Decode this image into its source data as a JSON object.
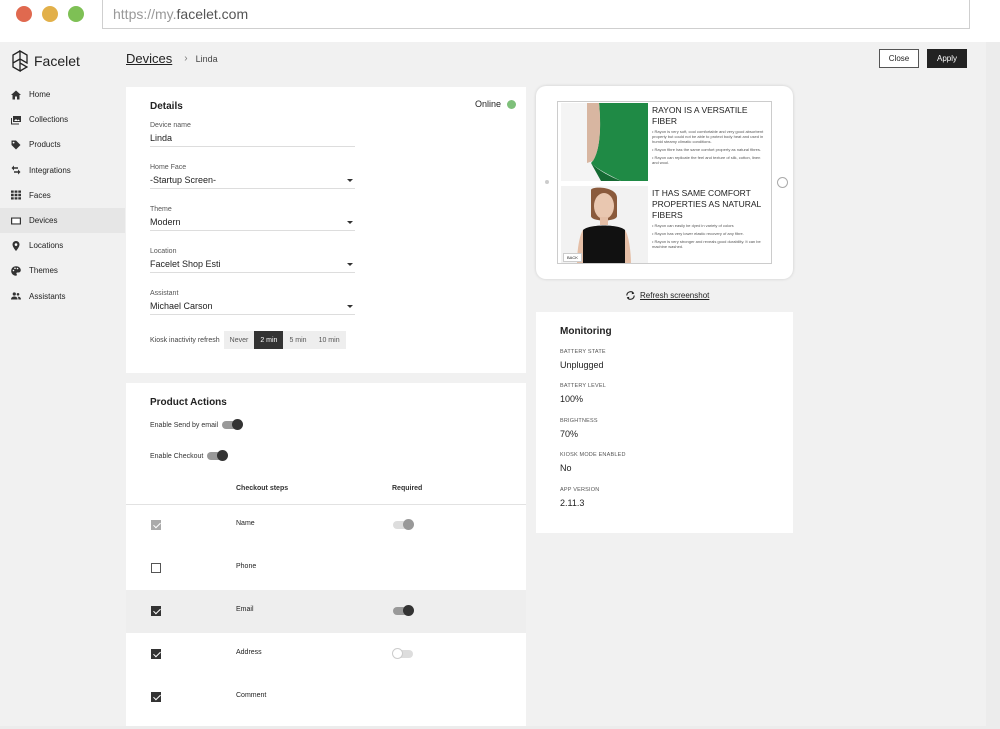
{
  "browser": {
    "url_scheme": "https://my.",
    "url_host": "facelet.com"
  },
  "app": {
    "logo_text": "Facelet"
  },
  "sidebar": {
    "items": [
      {
        "label": "Home",
        "icon": "home-icon"
      },
      {
        "label": "Collections",
        "icon": "collections-icon"
      },
      {
        "label": "Products",
        "icon": "tag-icon"
      },
      {
        "label": "Integrations",
        "icon": "swap-icon"
      },
      {
        "label": "Faces",
        "icon": "grid-icon"
      },
      {
        "label": "Devices",
        "icon": "tablet-icon",
        "active": true
      },
      {
        "label": "Locations",
        "icon": "pin-icon"
      },
      {
        "label": "Themes",
        "icon": "palette-icon"
      },
      {
        "label": "Assistants",
        "icon": "people-icon"
      }
    ]
  },
  "header": {
    "breadcrumb_root": "Devices",
    "breadcrumb_current": "Linda",
    "close_label": "Close",
    "apply_label": "Apply"
  },
  "details": {
    "title": "Details",
    "status": "Online",
    "status_color": "#7ec07a",
    "device_name_label": "Device name",
    "device_name_value": "Linda",
    "home_face_label": "Home Face",
    "home_face_value": "-Startup Screen-",
    "theme_label": "Theme",
    "theme_value": "Modern",
    "location_label": "Location",
    "location_value": "Facelet Shop Esti",
    "assistant_label": "Assistant",
    "assistant_value": "Michael Carson",
    "kiosk_label": "Kiosk inactivity refresh",
    "kiosk_options": [
      "Never",
      "2 min",
      "5 min",
      "10 min"
    ],
    "kiosk_selected": "2 min"
  },
  "product_actions": {
    "title": "Product Actions",
    "send_email_label": "Enable Send by email",
    "checkout_label": "Enable Checkout",
    "col_steps": "Checkout steps",
    "col_required": "Required",
    "rows": [
      {
        "name": "Name",
        "checked": true,
        "locked": true,
        "required": "on-locked"
      },
      {
        "name": "Phone",
        "checked": false,
        "locked": false,
        "required": "none"
      },
      {
        "name": "Email",
        "checked": true,
        "locked": false,
        "required": "on",
        "highlight": true
      },
      {
        "name": "Address",
        "checked": true,
        "locked": false,
        "required": "off"
      },
      {
        "name": "Comment",
        "checked": true,
        "locked": false,
        "required": "none"
      }
    ]
  },
  "preview": {
    "panel1_heading": "RAYON IS A VERSATILE FIBER",
    "panel1_p1": "• Rayon is very soft, cool comfortable and very good absorbent property but could not be able to protect body heat and used in humid steamy climatic conditions.",
    "panel1_p2": "• Rayon fibre has the same comfort property as natural fibres.",
    "panel1_p3": "• Rayon can replicate the feel and texture of silk, cotton, linen and wool.",
    "panel2_heading": "IT HAS SAME COMFORT PROPERTIES AS NATURAL FIBERS",
    "panel2_p1": "• Rayon can easily be dyed in variety of colors",
    "panel2_p2": "• Rayon has very lower elastic recovery of any fibre.",
    "panel2_p3": "• Rayon is very stronger and reveals good durability. It can be machine washed.",
    "back_label": "BACK",
    "refresh_label": "Refresh screenshot"
  },
  "monitoring": {
    "title": "Monitoring",
    "items": [
      {
        "label": "BATTERY STATE",
        "value": "Unplugged"
      },
      {
        "label": "BATTERY LEVEL",
        "value": "100%"
      },
      {
        "label": "BRIGHTNESS",
        "value": "70%"
      },
      {
        "label": "KIOSK MODE ENABLED",
        "value": "No"
      },
      {
        "label": "APP VERSION",
        "value": "2.11.3"
      }
    ]
  }
}
